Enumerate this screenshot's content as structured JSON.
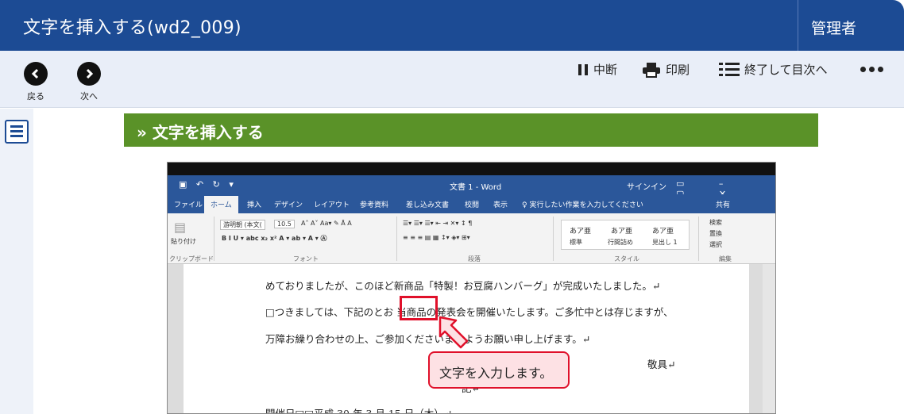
{
  "header": {
    "title": "文字を挿入する(wd2_009)",
    "user": "管理者"
  },
  "toolbar": {
    "back_label": "戻る",
    "next_label": "次へ",
    "pause_label": "中断",
    "print_label": "印刷",
    "finish_label": "終了して目次へ"
  },
  "section": {
    "title": "» 文字を挿入する"
  },
  "word": {
    "doc_title": "文書 1 - Word",
    "signin": "サインイン",
    "tabs": [
      "ファイル",
      "ホーム",
      "挿入",
      "デザイン",
      "レイアウト",
      "参考資料",
      "差し込み文書",
      "校閲",
      "表示"
    ],
    "tell_me": "♀ 実行したい作業を入力してください",
    "share": "共有",
    "ribbon": {
      "paste": "貼り付け",
      "font_name": "游明朝 (本文(",
      "font_size": "10.5",
      "groups": [
        "クリップボード",
        "フォント",
        "段落",
        "スタイル",
        "編集"
      ],
      "styles": [
        "あア亜",
        "あア亜",
        "あア亜"
      ],
      "style_names": [
        "標準",
        "行間詰め",
        "見出し 1"
      ],
      "edit": [
        "検索",
        "置換",
        "選択"
      ]
    },
    "lines": [
      "めておりましたが、このほど新商品「特製！お豆腐ハンバーグ」が完成いたしました。↵",
      "□つきましては、下記のとお 当商品の発表会を開催いたします。ご多忙中とは存じますが、",
      "万障お繰り合わせの上、ご参加くださいますようお願い申し上げます。↵",
      "敬具↵",
      "記↵",
      "開催日□□平成 30 年 3 月 15 日（木）↵"
    ]
  },
  "callout": {
    "text": "文字を入力します。"
  }
}
